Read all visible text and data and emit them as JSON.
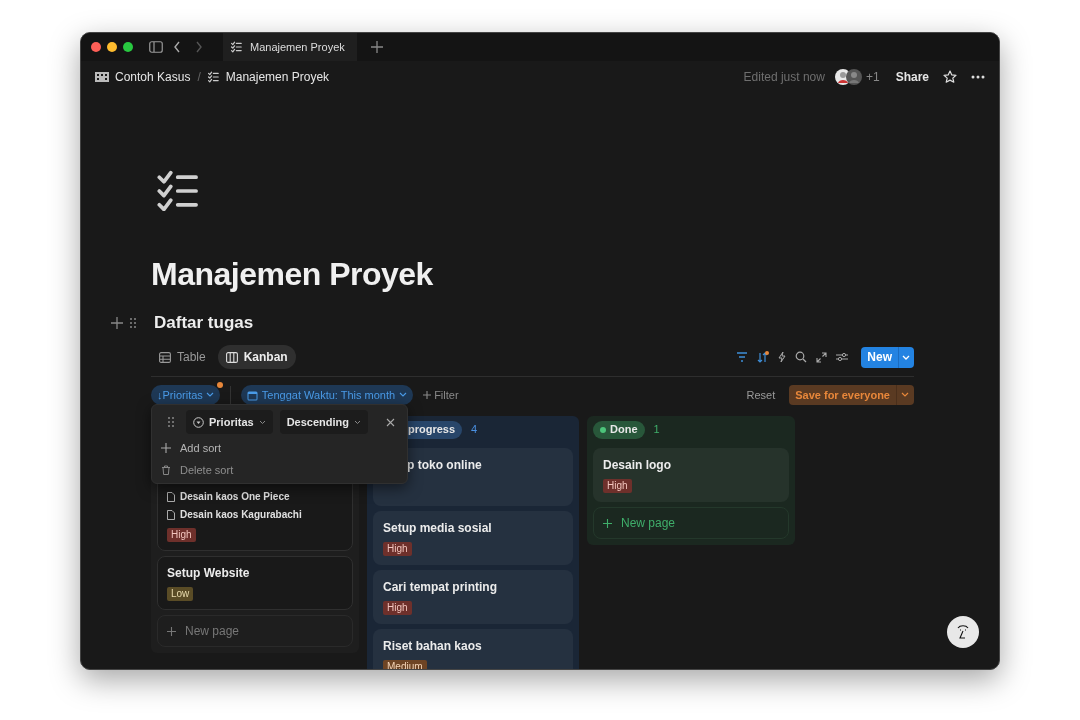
{
  "browser": {
    "tab_title": "Manajemen Proyek"
  },
  "breadcrumb": [
    {
      "label": "Contoh Kasus",
      "kind": "workspace"
    },
    {
      "label": "Manajemen Proyek",
      "kind": "page"
    }
  ],
  "breadcrumb_separator": "/",
  "top_bar": {
    "edited": "Edited just now",
    "extra_collaborators": "+1",
    "share": "Share"
  },
  "page": {
    "title": "Manajemen Proyek"
  },
  "database": {
    "title": "Daftar tugas",
    "views": [
      {
        "label": "Table",
        "kind": "table",
        "selected": false
      },
      {
        "label": "Kanban",
        "kind": "board",
        "selected": true
      }
    ],
    "new_button": "New",
    "sort_unsaved": true,
    "sort_arrow": "↓",
    "sort_chip": "Prioritas",
    "filter_chip": "Tenggat Waktu: This month",
    "add_filter": "Filter",
    "reset": "Reset",
    "save": "Save for everyone"
  },
  "sort_menu": {
    "property": "Prioritas",
    "direction": "Descending",
    "add": "Add sort",
    "delete": "Delete sort"
  },
  "columns": [
    {
      "color": "#1e1e1e",
      "cards": [
        {
          "subitems": [
            "Desain kaos One Piece",
            "Desain kaos Kagurabachi"
          ],
          "tag": {
            "label": "High",
            "kind": "high"
          }
        },
        {
          "title": "Setup Website",
          "tag": {
            "label": "Low",
            "kind": "low"
          }
        }
      ],
      "new_page": "New page"
    },
    {
      "color": "#1a2636",
      "clipped": true,
      "label": "progress",
      "count": "4",
      "cards": [
        {
          "title": "p toko online",
          "clipped": true
        },
        {
          "title": "Setup media sosial",
          "tag": {
            "label": "High",
            "kind": "high"
          }
        },
        {
          "title": "Cari tempat printing",
          "tag": {
            "label": "High",
            "kind": "high"
          }
        },
        {
          "title": "Riset bahan kaos",
          "tag": {
            "label": "Medium",
            "kind": "medium"
          }
        }
      ]
    },
    {
      "color": "#1b2820",
      "label": "Done",
      "count": "1",
      "dot": true,
      "cards": [
        {
          "title": "Desain logo",
          "tag": {
            "label": "High",
            "kind": "high"
          }
        }
      ],
      "new_page": "New page"
    }
  ]
}
